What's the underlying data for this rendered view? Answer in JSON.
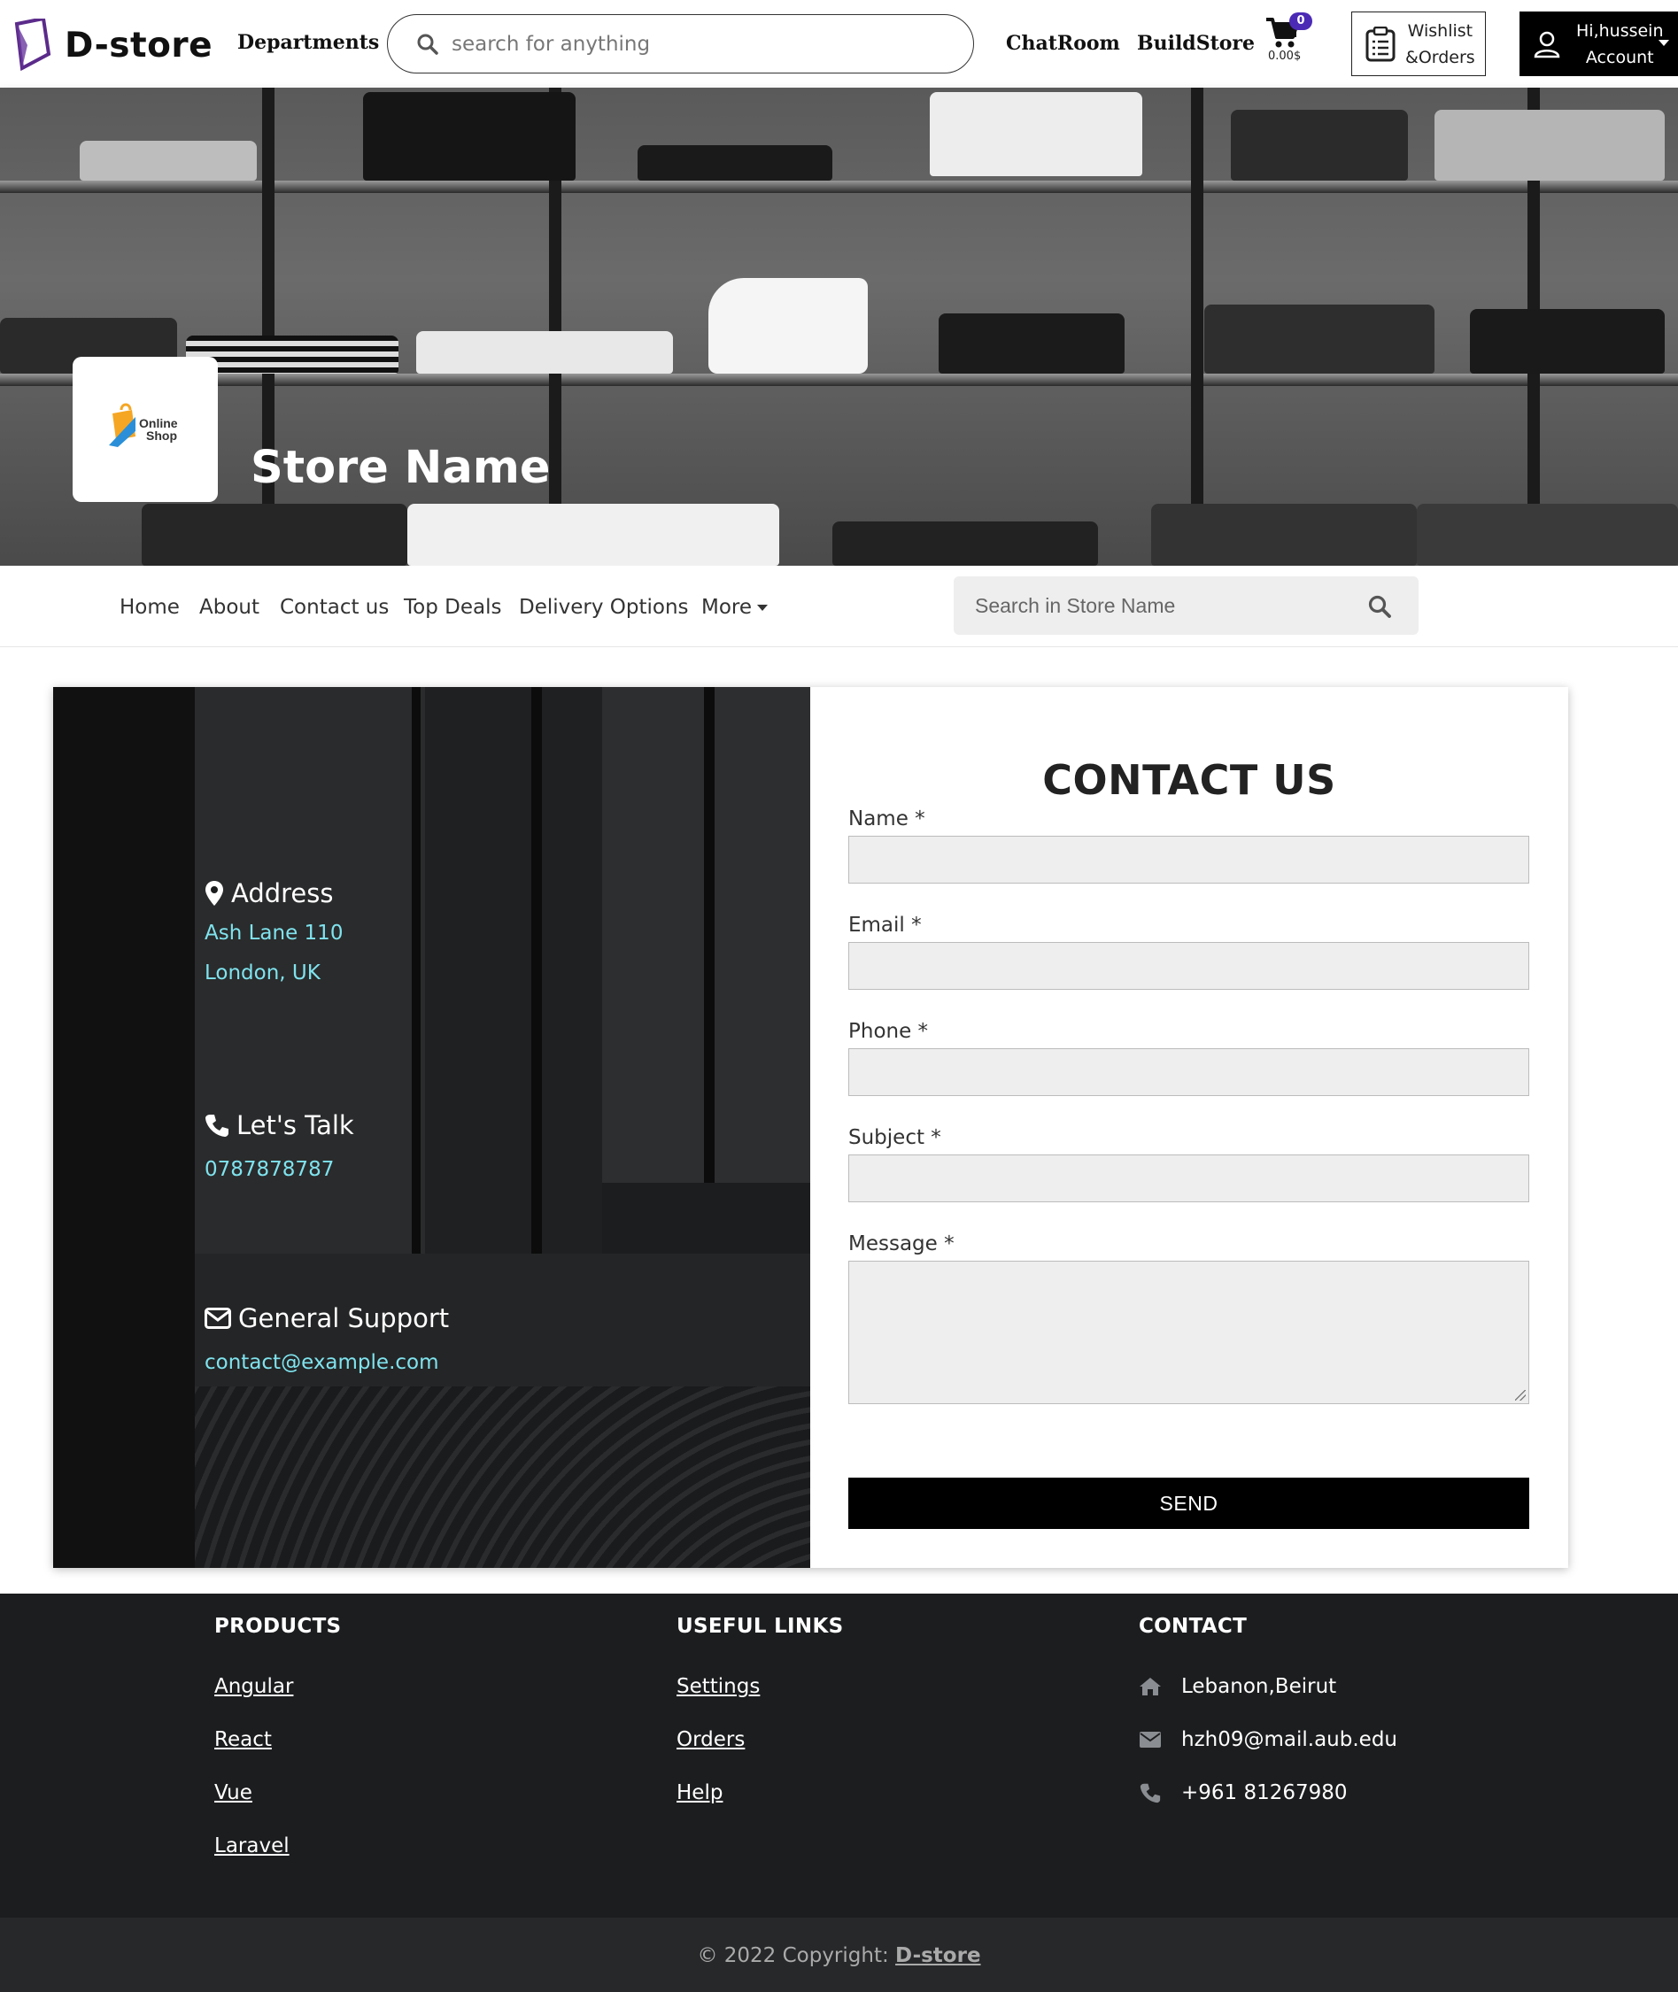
{
  "header": {
    "logo_text": "D-store",
    "departments": "Departments",
    "search_placeholder": "search for anything",
    "chatroom": "ChatRoom",
    "buildstore": "BuildStore",
    "cart_count": "0",
    "cart_total": "0.00$",
    "wishlist_line1": "Wishlist",
    "wishlist_line2": "&Orders",
    "account_line1": "Hi,hussein",
    "account_line2": "Account"
  },
  "banner": {
    "store_name": "Store Name",
    "logo_text_1": "Online",
    "logo_text_2": "Shop"
  },
  "store_nav": {
    "items": [
      "Home",
      "About",
      "Contact us",
      "Top Deals",
      "Delivery Options",
      "More"
    ],
    "search_placeholder": "Search in Store Name"
  },
  "contact_info": {
    "address_title": "Address",
    "address_line1": "Ash Lane 110",
    "address_line2": "London, UK",
    "talk_title": "Let's Talk",
    "phone": "0787878787",
    "support_title": "General Support",
    "email": "contact@example.com"
  },
  "contact_form": {
    "title": "CONTACT US",
    "name_label": "Name *",
    "email_label": "Email *",
    "phone_label": "Phone *",
    "subject_label": "Subject *",
    "message_label": "Message *",
    "send_label": "SEND"
  },
  "footer": {
    "products_title": "PRODUCTS",
    "products": [
      "Angular",
      "React",
      "Vue",
      "Laravel"
    ],
    "links_title": "USEFUL LINKS",
    "links": [
      "Settings",
      "Orders",
      "Help"
    ],
    "contact_title": "CONTACT",
    "location": "Lebanon,Beirut",
    "email": "hzh09@mail.aub.edu",
    "phone": "+961 81267980",
    "copyright_prefix": "© 2022 Copyright:",
    "copyright_brand": "D-store"
  },
  "colors": {
    "accent_purple": "#4b2bb5",
    "info_text": "#7fe3ee",
    "footer_bg": "#1c1d1f",
    "copyright_bg": "#27282a"
  }
}
